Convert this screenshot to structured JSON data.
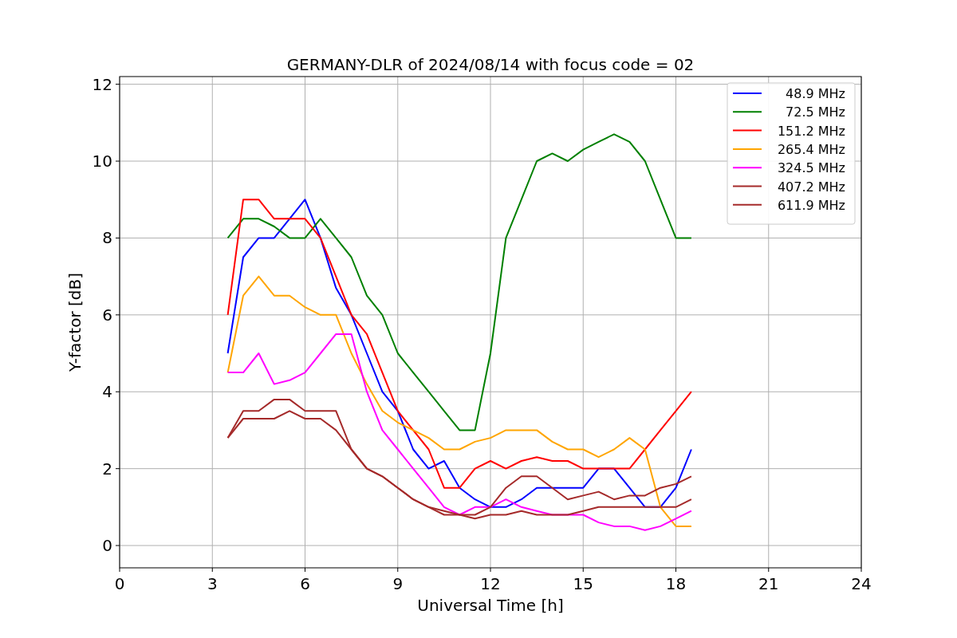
{
  "figure": {
    "chart_data": {
      "type": "line",
      "title": "GERMANY-DLR of 2024/08/14 with focus code = 02",
      "xlabel": "Universal Time [h]",
      "ylabel": "Y-factor [dB]",
      "x": [
        3.5,
        4,
        4.5,
        5,
        5.5,
        6,
        6.5,
        7,
        7.5,
        8,
        8.5,
        9,
        9.5,
        10,
        10.5,
        11,
        11.5,
        12,
        12.5,
        13,
        13.5,
        14,
        14.5,
        15,
        15.5,
        16,
        16.5,
        17,
        17.5,
        18,
        18.5
      ],
      "series": [
        {
          "name": "48.9 MHz",
          "color": "#0000ff",
          "values": [
            5,
            7.5,
            8,
            8,
            8.5,
            9,
            8,
            6.7,
            6,
            5,
            4,
            3.5,
            2.5,
            2,
            2.2,
            1.5,
            1.2,
            1,
            1,
            1.2,
            1.5,
            1.5,
            1.5,
            1.5,
            2,
            2,
            1.5,
            1,
            1,
            1.5,
            2.5
          ]
        },
        {
          "name": "72.5 MHz",
          "color": "#008000",
          "values": [
            8,
            8.5,
            8.5,
            8.3,
            8,
            8,
            8.5,
            8,
            7.5,
            6.5,
            6,
            5,
            4.5,
            4,
            3.5,
            3,
            3,
            5,
            8,
            9,
            10,
            10.2,
            10,
            10.3,
            10.5,
            10.7,
            10.5,
            10,
            9,
            8,
            8
          ]
        },
        {
          "name": "151.2 MHz",
          "color": "#ff0000",
          "values": [
            6,
            9,
            9,
            8.5,
            8.5,
            8.5,
            8,
            7,
            6,
            5.5,
            4.5,
            3.5,
            3,
            2.5,
            1.5,
            1.5,
            2,
            2.2,
            2,
            2.2,
            2.3,
            2.2,
            2.2,
            2,
            2,
            2,
            2,
            2.5,
            3,
            3.5,
            4
          ]
        },
        {
          "name": "265.4 MHz",
          "color": "#ffa500",
          "values": [
            4.5,
            6.5,
            7,
            6.5,
            6.5,
            6.2,
            6,
            6,
            5,
            4.2,
            3.5,
            3.2,
            3,
            2.8,
            2.5,
            2.5,
            2.7,
            2.8,
            3,
            3,
            3,
            2.7,
            2.5,
            2.5,
            2.3,
            2.5,
            2.8,
            2.5,
            1,
            0.5,
            0.5
          ]
        },
        {
          "name": "324.5 MHz",
          "color": "#ff00ff",
          "values": [
            4.5,
            4.5,
            5,
            4.2,
            4.3,
            4.5,
            5,
            5.5,
            5.5,
            4,
            3,
            2.5,
            2,
            1.5,
            1,
            0.8,
            1,
            1,
            1.2,
            1,
            0.9,
            0.8,
            0.8,
            0.8,
            0.6,
            0.5,
            0.5,
            0.4,
            0.5,
            0.7,
            0.9
          ]
        },
        {
          "name": "407.2 MHz",
          "color": "#a52a2a",
          "values": [
            2.8,
            3.3,
            3.3,
            3.3,
            3.5,
            3.3,
            3.3,
            3,
            2.5,
            2,
            1.8,
            1.5,
            1.2,
            1,
            0.9,
            0.8,
            0.7,
            0.8,
            0.8,
            0.9,
            0.8,
            0.8,
            0.8,
            0.9,
            1,
            1,
            1,
            1,
            1,
            1,
            1.2
          ]
        },
        {
          "name": "611.9 MHz",
          "color": "#a52a2a",
          "values": [
            2.8,
            3.5,
            3.5,
            3.8,
            3.8,
            3.5,
            3.5,
            3.5,
            2.5,
            2,
            1.8,
            1.5,
            1.2,
            1,
            0.8,
            0.8,
            0.8,
            1,
            1.5,
            1.8,
            1.8,
            1.5,
            1.2,
            1.3,
            1.4,
            1.2,
            1.3,
            1.3,
            1.5,
            1.6,
            1.8
          ]
        }
      ],
      "grid": true,
      "legend": true,
      "xlim": [
        0,
        24
      ],
      "ylim": [
        -0.58,
        12.2
      ],
      "xticks": [
        0,
        3,
        6,
        9,
        12,
        15,
        18,
        21,
        24
      ],
      "yticks": [
        0,
        2,
        4,
        6,
        8,
        10,
        12
      ]
    }
  }
}
